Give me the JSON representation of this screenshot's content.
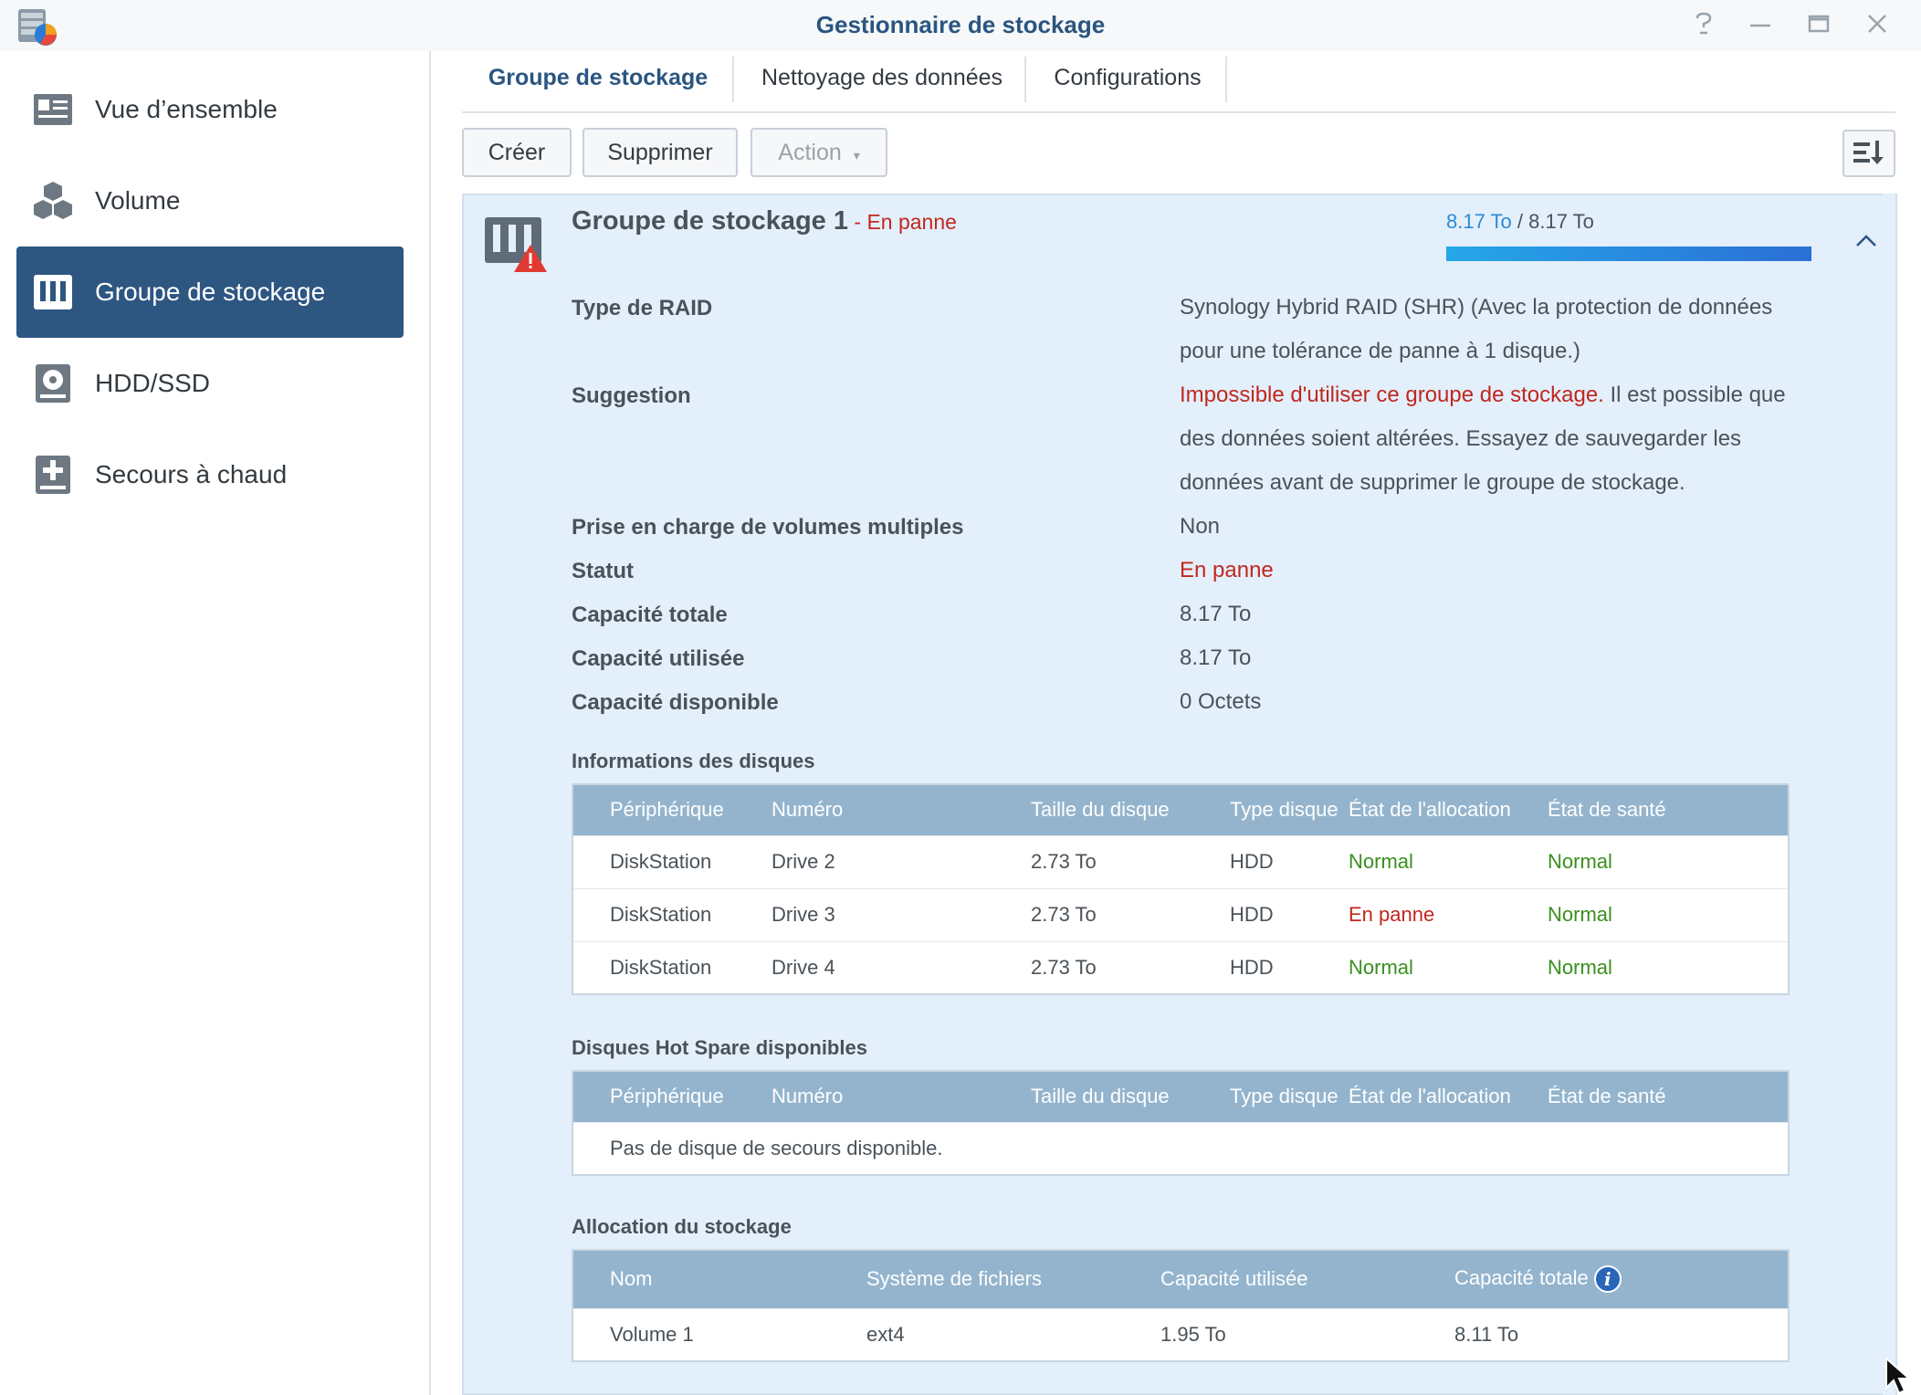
{
  "window": {
    "title": "Gestionnaire de stockage"
  },
  "sidebar": {
    "items": [
      {
        "label": "Vue d’ensemble",
        "icon": "overview-icon"
      },
      {
        "label": "Volume",
        "icon": "cubes-icon"
      },
      {
        "label": "Groupe de stockage",
        "icon": "storage-pool-icon",
        "active": true
      },
      {
        "label": "HDD/SSD",
        "icon": "hdd-icon"
      },
      {
        "label": "Secours à chaud",
        "icon": "hot-spare-icon"
      }
    ]
  },
  "tabs": [
    {
      "label": "Groupe de stockage",
      "active": true
    },
    {
      "label": "Nettoyage des données"
    },
    {
      "label": "Configurations"
    }
  ],
  "toolbar": {
    "create": "Créer",
    "delete": "Supprimer",
    "action": "Action"
  },
  "pool": {
    "title": "Groupe de stockage 1",
    "status_sep": " - ",
    "status": "En panne",
    "usage_used": "8.17 To",
    "usage_sep": " / ",
    "usage_total": "8.17 To",
    "usage_fraction": 1.0
  },
  "details": {
    "raid_label": "Type de RAID",
    "raid_value": "Synology Hybrid RAID (SHR) (Avec la protection de données pour une tolérance de panne à 1 disque.)",
    "suggestion_label": "Suggestion",
    "suggestion_warning": "Impossible d'utiliser ce groupe de stockage.",
    "suggestion_text": " Il est possible que des données soient altérées. Essayez de sauvegarder les données avant de supprimer le groupe de stockage.",
    "multi_label": "Prise en charge de volumes multiples",
    "multi_value": "Non",
    "status_label": "Statut",
    "status_value": "En panne",
    "total_label": "Capacité totale",
    "total_value": "8.17 To",
    "used_label": "Capacité utilisée",
    "used_value": "8.17 To",
    "free_label": "Capacité disponible",
    "free_value": "0 Octets"
  },
  "disks": {
    "title": "Informations des disques",
    "headers": [
      "Périphérique",
      "Numéro",
      "Taille du disque",
      "Type disque",
      "État de l'allocation",
      "État de santé"
    ],
    "rows": [
      [
        "DiskStation",
        "Drive 2",
        "2.73 To",
        "HDD",
        "Normal",
        "Normal"
      ],
      [
        "DiskStation",
        "Drive 3",
        "2.73 To",
        "HDD",
        "En panne",
        "Normal"
      ],
      [
        "DiskStation",
        "Drive 4",
        "2.73 To",
        "HDD",
        "Normal",
        "Normal"
      ]
    ]
  },
  "hotspare": {
    "title": "Disques Hot Spare disponibles",
    "headers": [
      "Périphérique",
      "Numéro",
      "Taille du disque",
      "Type disque",
      "État de l'allocation",
      "État de santé"
    ],
    "empty": "Pas de disque de secours disponible."
  },
  "allocation": {
    "title": "Allocation du stockage",
    "headers": [
      "Nom",
      "Système de fichiers",
      "Capacité utilisée",
      "Capacité totale"
    ],
    "rows": [
      [
        "Volume 1",
        "ext4",
        "1.95 To",
        "8.11 To"
      ]
    ]
  },
  "colors": {
    "accent": "#2d5681",
    "error": "#c0281f",
    "ok": "#3a8f1e",
    "panel": "#e3effa"
  }
}
